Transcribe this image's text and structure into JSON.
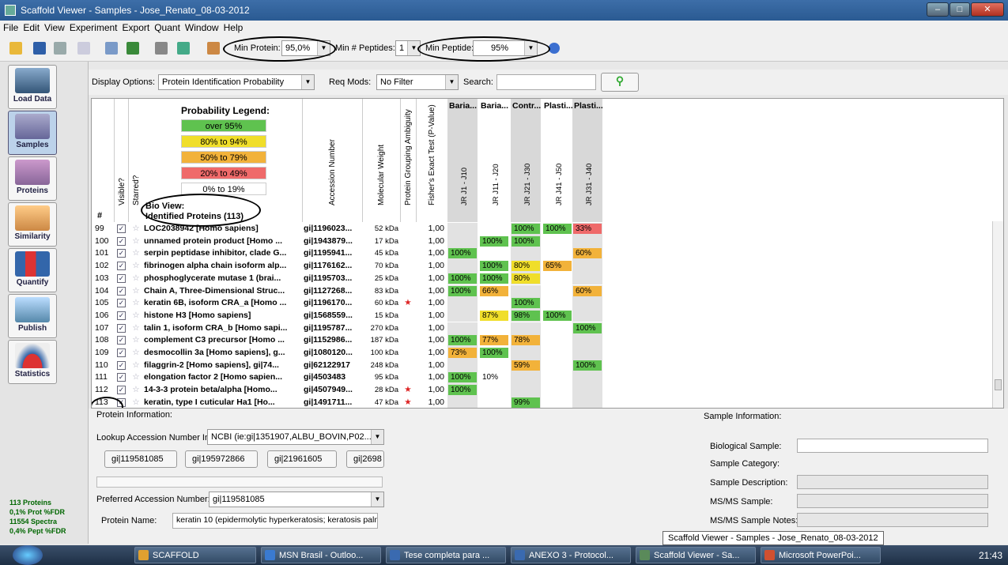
{
  "window": {
    "title": "Scaffold Viewer - Samples - Jose_Renato_08-03-2012"
  },
  "menu": [
    "File",
    "Edit",
    "View",
    "Experiment",
    "Export",
    "Quant",
    "Window",
    "Help"
  ],
  "toolbar": {
    "min_protein_label": "Min Protein:",
    "min_protein_value": "95,0%",
    "min_peptides_label": "Min # Peptides:",
    "min_peptides_value": "1",
    "min_peptide_label": "Min Peptide:",
    "min_peptide_value": "95%"
  },
  "sidebar": {
    "buttons": [
      "Load Data",
      "Samples",
      "Proteins",
      "Similarity",
      "Quantify",
      "Publish",
      "Statistics"
    ],
    "active": "Samples",
    "stats": [
      "113 Proteins",
      "0,1% Prot %FDR",
      "11554 Spectra",
      "0,4% Pept %FDR"
    ]
  },
  "options": {
    "display_label": "Display Options:",
    "display_value": "Protein Identification Probability",
    "reqmods_label": "Req Mods:",
    "reqmods_value": "No Filter",
    "search_label": "Search:",
    "search_value": ""
  },
  "legend": {
    "title": "Probability Legend:",
    "items": [
      {
        "label": "over 95%",
        "color": "#5fc24f"
      },
      {
        "label": "80% to 94%",
        "color": "#f0de2a"
      },
      {
        "label": "50% to 79%",
        "color": "#f2b23a"
      },
      {
        "label": "20% to  49%",
        "color": "#ef6a6a"
      },
      {
        "label": "0% to 19%",
        "color": "#ffffff"
      }
    ]
  },
  "bioview": {
    "line1": "Bio View:",
    "line2": "Identified Proteins (113)"
  },
  "columns": {
    "number": "#",
    "visible": "Visible?",
    "starred": "Starred?",
    "accession": "Accession Number",
    "mw": "Molecular Weight",
    "grouping": "Protein Grouping Ambiguity",
    "fisher": "Fisher's Exact Test (P-Value)",
    "groups": [
      "Baria...",
      "Baria...",
      "Contr...",
      "Plasti...",
      "Plasti..."
    ],
    "samples": [
      "JR J1 - J10",
      "JR J11 - J20",
      "JR J21 - J30",
      "JR J41 - J50",
      "JR J31 - J40"
    ]
  },
  "rows": [
    {
      "n": "99",
      "name": "LOC2038942 [Homo sapiens]",
      "acc": "gi|1196023...",
      "mw": "52 kDa",
      "amb": false,
      "p": "1,00",
      "s": [
        "",
        "",
        "100%",
        "100%",
        "33%"
      ]
    },
    {
      "n": "100",
      "name": "unnamed protein product [Homo ...",
      "acc": "gi|1943879...",
      "mw": "17 kDa",
      "amb": false,
      "p": "1,00",
      "s": [
        "",
        "100%",
        "100%",
        "",
        ""
      ]
    },
    {
      "n": "101",
      "name": "serpin peptidase inhibitor, clade G...",
      "acc": "gi|1195941...",
      "mw": "45 kDa",
      "amb": false,
      "p": "1,00",
      "s": [
        "100%",
        "",
        "",
        "",
        "60%"
      ]
    },
    {
      "n": "102",
      "name": "fibrinogen alpha chain isoform alp...",
      "acc": "gi|1176162...",
      "mw": "70 kDa",
      "amb": false,
      "p": "1,00",
      "s": [
        "",
        "100%",
        "80%",
        "65%",
        ""
      ]
    },
    {
      "n": "103",
      "name": "phosphoglycerate mutase 1 (brai...",
      "acc": "gi|1195703...",
      "mw": "25 kDa",
      "amb": false,
      "p": "1,00",
      "s": [
        "100%",
        "100%",
        "80%",
        "",
        ""
      ]
    },
    {
      "n": "104",
      "name": "Chain A, Three-Dimensional Struc...",
      "acc": "gi|1127268...",
      "mw": "83 kDa",
      "amb": false,
      "p": "1,00",
      "s": [
        "100%",
        "66%",
        "",
        "",
        "60%"
      ]
    },
    {
      "n": "105",
      "name": "keratin 6B, isoform CRA_a [Homo ...",
      "acc": "gi|1196170...",
      "mw": "60 kDa",
      "amb": true,
      "p": "1,00",
      "s": [
        "",
        "",
        "100%",
        "",
        ""
      ]
    },
    {
      "n": "106",
      "name": "histone H3 [Homo sapiens]",
      "acc": "gi|1568559...",
      "mw": "15 kDa",
      "amb": false,
      "p": "1,00",
      "s": [
        "",
        "87%",
        "98%",
        "100%",
        ""
      ]
    },
    {
      "n": "107",
      "name": "talin 1, isoform CRA_b [Homo sapi...",
      "acc": "gi|1195787...",
      "mw": "270 kDa",
      "amb": false,
      "p": "1,00",
      "s": [
        "",
        "",
        "",
        "",
        "100%"
      ]
    },
    {
      "n": "108",
      "name": "complement C3 precursor [Homo ...",
      "acc": "gi|1152986...",
      "mw": "187 kDa",
      "amb": false,
      "p": "1,00",
      "s": [
        "100%",
        "77%",
        "78%",
        "",
        ""
      ]
    },
    {
      "n": "109",
      "name": "desmocollin 3a [Homo sapiens], g...",
      "acc": "gi|1080120...",
      "mw": "100 kDa",
      "amb": false,
      "p": "1,00",
      "s": [
        "73%",
        "100%",
        "",
        "",
        ""
      ]
    },
    {
      "n": "110",
      "name": "filaggrin-2 [Homo sapiens], gi|74...",
      "acc": "gi|62122917",
      "mw": "248 kDa",
      "amb": false,
      "p": "1,00",
      "s": [
        "",
        "",
        "59%",
        "",
        "100%"
      ]
    },
    {
      "n": "111",
      "name": "elongation factor 2 [Homo sapien...",
      "acc": "gi|4503483",
      "mw": "95 kDa",
      "amb": false,
      "p": "1,00",
      "s": [
        "100%",
        "10%",
        "",
        "",
        ""
      ]
    },
    {
      "n": "112",
      "name": "14-3-3 protein beta/alpha [Homo...",
      "acc": "gi|4507949...",
      "mw": "28 kDa",
      "amb": true,
      "p": "1,00",
      "s": [
        "100%",
        "",
        "",
        "",
        ""
      ]
    },
    {
      "n": "113",
      "name": "keratin, type I cuticular Ha1 [Ho...",
      "acc": "gi|1491711...",
      "mw": "47 kDa",
      "amb": true,
      "p": "1,00",
      "s": [
        "",
        "",
        "99%",
        "",
        ""
      ]
    }
  ],
  "protein_info": {
    "title": "Protein Information:",
    "lookup_label": "Lookup Accession Number In:",
    "lookup_value": "NCBI (ie:gi|1351907,ALBU_BOVIN,P02...",
    "accessions": [
      "gi|119581085",
      "gi|195972866",
      "gi|21961605",
      "gi|2698"
    ],
    "preferred_label": "Preferred Accession Number:",
    "preferred_value": "gi|119581085",
    "name_label": "Protein Name:",
    "name_value": "keratin 10 (epidermolytic hyperkeratosis; keratosis palmar"
  },
  "sample_info": {
    "title": "Sample Information:",
    "fields": [
      "Biological Sample:",
      "Sample Category:",
      "Sample Description:",
      "MS/MS Sample:",
      "MS/MS Sample Notes:"
    ]
  },
  "tooltip": "Scaffold Viewer - Samples - Jose_Renato_08-03-2012",
  "taskbar": {
    "tasks": [
      "SCAFFOLD",
      "MSN Brasil - Outloo...",
      "Tese completa para ...",
      "ANEXO 3 - Protocol...",
      "Scaffold Viewer - Sa...",
      "Microsoft PowerPoi..."
    ],
    "time": "21:43"
  }
}
